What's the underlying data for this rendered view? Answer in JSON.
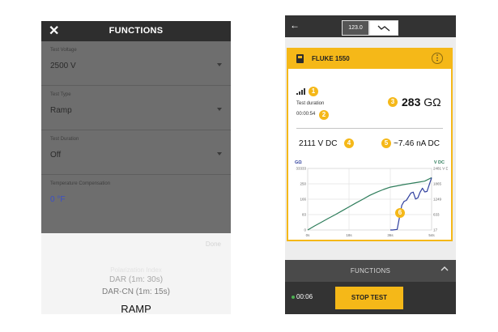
{
  "left_screen": {
    "header": {
      "close_icon": "x-close-icon",
      "title": "FUNCTIONS"
    },
    "fields": [
      {
        "label": "Test Voltage",
        "value": "2500 V"
      },
      {
        "label": "Test Type",
        "value": "Ramp"
      },
      {
        "label": "Test Duration",
        "value": "Off"
      },
      {
        "label": "Temperature Compensation",
        "value": "0 °F"
      }
    ],
    "picker": {
      "done_label": "Done",
      "options": [
        "Polarization Index",
        "DAR (1m: 30s)",
        "DAR-CN (1m: 15s)",
        "RAMP"
      ],
      "selected": "RAMP"
    }
  },
  "right_screen": {
    "top_bar": {
      "back_icon": "arrow-left-icon",
      "tab_numeric_label": "123.0",
      "tab_graph_icon": "trend-graph-icon"
    },
    "device_card": {
      "device_name": "FLUKE 1550",
      "menu_icon": "kebab-menu-icon",
      "signal_icon": "signal-strength-icon",
      "test_duration_label": "Test duration",
      "test_duration_value": "00:00:54",
      "resistance_value": "283",
      "resistance_unit": "GΩ",
      "voltage_reading": "2111 V DC",
      "current_reading": "~7.46 nA DC",
      "callouts": [
        "1",
        "2",
        "3",
        "4",
        "5",
        "6"
      ]
    },
    "functions_bar": {
      "title": "FUNCTIONS",
      "chevron_icon": "chevron-up-icon"
    },
    "bottom_bar": {
      "status_color": "#4caf50",
      "elapsed": "00:06",
      "stop_label": "STOP TEST"
    }
  },
  "colors": {
    "accent": "#f5b818",
    "resistance_series": "#2e7d5b",
    "voltage_series": "#2f3f9e",
    "dark_bar": "#333333"
  },
  "chart_data": {
    "type": "line",
    "x_ticks": [
      "0s",
      "18s",
      "36s",
      "54s"
    ],
    "xlim": [
      0,
      54
    ],
    "left_axis": {
      "label": "GΩ",
      "ticks": [
        "0",
        "83",
        "166",
        "250",
        "33333"
      ],
      "ylim": [
        0,
        333
      ]
    },
    "right_axis": {
      "label": "V DC",
      "ticks": [
        "17",
        "633",
        "1249",
        "1865",
        "2481 V DC"
      ],
      "ylim": [
        17,
        2481
      ]
    },
    "grid": true,
    "series": [
      {
        "axis": "left",
        "color": "#2e7d5b",
        "x": [
          0,
          3,
          6,
          9,
          12,
          15,
          18,
          21,
          24,
          27,
          30,
          33,
          36,
          39,
          42,
          45,
          48,
          51,
          54
        ],
        "y": [
          0,
          22,
          42,
          63,
          83,
          104,
          125,
          146,
          166,
          187,
          204,
          219,
          232,
          239,
          246,
          252,
          258,
          264,
          283
        ]
      },
      {
        "axis": "right",
        "color": "#2f3f9e",
        "x": [
          36,
          37,
          39,
          41,
          42,
          43,
          45,
          46,
          47,
          48,
          49,
          50,
          51,
          52,
          53,
          54
        ],
        "y": [
          17,
          17,
          40,
          1005,
          1160,
          1200,
          1500,
          1530,
          1255,
          1300,
          1530,
          1690,
          1540,
          1560,
          1840,
          2111
        ]
      }
    ]
  }
}
